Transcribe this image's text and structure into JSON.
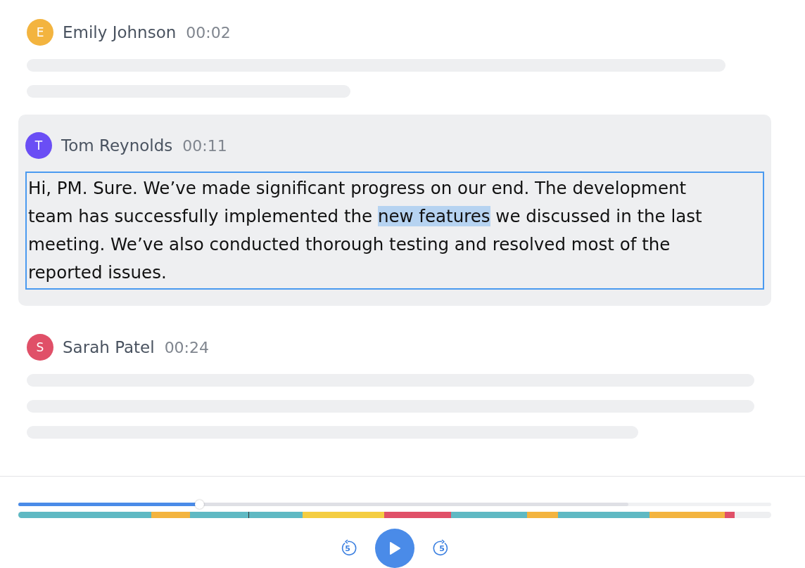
{
  "entries": [
    {
      "speaker": "Emily Johnson",
      "initial": "E",
      "color": "#f3b43f",
      "time": "00:02",
      "selected": false,
      "skeleton_lines": [
        {
          "kind": "long"
        },
        {
          "kind": "short"
        }
      ]
    },
    {
      "speaker": "Tom Reynolds",
      "initial": "T",
      "color": "#6a4ef5",
      "time": "00:11",
      "selected": true,
      "text_before": "Hi, PM. Sure. We’ve made significant progress on our end. The development team has successfully implemented the ",
      "highlighted": "new features",
      "text_after": " we discussed in the last meeting. We’ve also conducted thorough testing and resolved most of the reported issues."
    },
    {
      "speaker": "Sarah Patel",
      "initial": "S",
      "color": "#e05068",
      "time": "00:24",
      "selected": false,
      "skeleton_lines": [
        {
          "kind": "full"
        },
        {
          "kind": "full"
        },
        {
          "kind": "medium"
        }
      ]
    }
  ],
  "player": {
    "played": {
      "level": 0.24
    },
    "buffered": {
      "level": 0.81
    },
    "segments": [
      {
        "color": "#5fb9c3"
      },
      {
        "color": "#f3b43f"
      },
      {
        "color": "#5fb9c3"
      },
      {
        "color": "#5fb9c3"
      },
      {
        "color": "#f4cd41"
      },
      {
        "color": "#e05068"
      },
      {
        "color": "#5fb9c3"
      },
      {
        "color": "#f3b43f"
      },
      {
        "color": "#5fb9c3"
      },
      {
        "color": "#f3b43f"
      },
      {
        "color": "#e05068"
      }
    ],
    "rewind_label": "5",
    "forward_label": "5"
  }
}
